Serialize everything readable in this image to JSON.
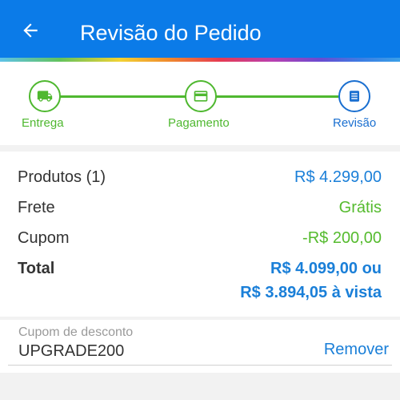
{
  "header": {
    "title": "Revisão do Pedido",
    "back_icon": "arrow-left-icon"
  },
  "colors": {
    "primary": "#0b7be8",
    "success": "#4fb830",
    "active": "#1a6fd0",
    "price_blue": "#1a7fd8",
    "discount_green": "#55bb2e"
  },
  "steps": [
    {
      "label": "Entrega",
      "icon": "truck-icon",
      "state": "done"
    },
    {
      "label": "Pagamento",
      "icon": "credit-card-icon",
      "state": "done"
    },
    {
      "label": "Revisão",
      "icon": "list-icon",
      "state": "active"
    }
  ],
  "summary": {
    "products_label": "Produtos (1)",
    "products_value": "R$ 4.299,00",
    "shipping_label": "Frete",
    "shipping_value": "Grátis",
    "coupon_label": "Cupom",
    "coupon_value": "-R$ 200,00",
    "total_label": "Total",
    "total_value_line1": "R$ 4.099,00 ou",
    "total_value_line2": "R$ 3.894,05 à vista"
  },
  "coupon": {
    "caption": "Cupom de desconto",
    "code": "UPGRADE200",
    "remove_label": "Remover"
  }
}
